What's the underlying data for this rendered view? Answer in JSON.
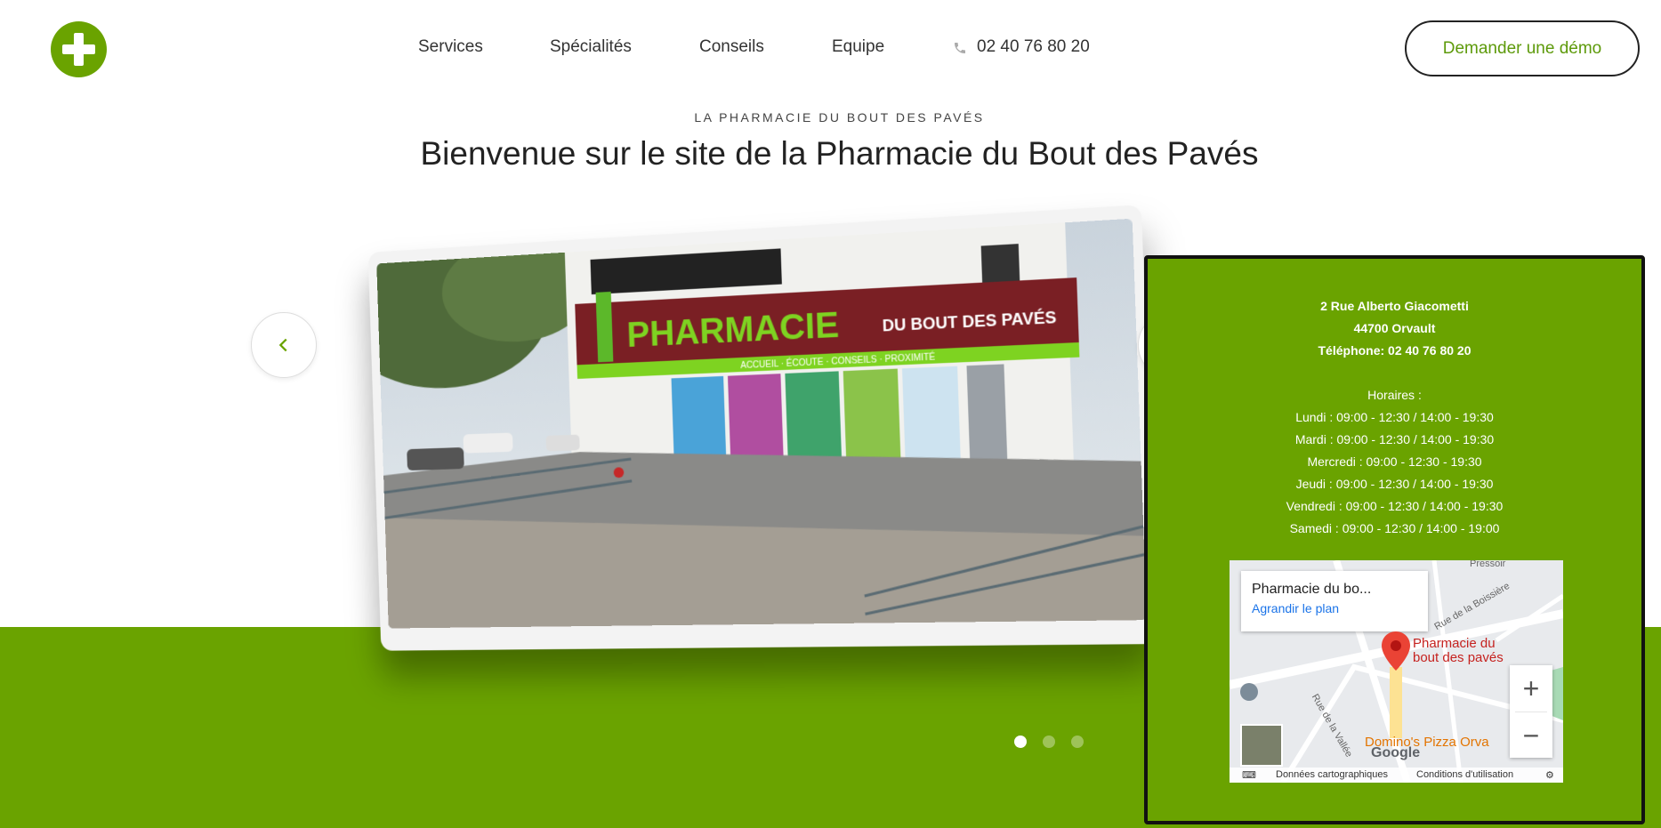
{
  "header": {
    "logo_icon": "plus-cross-icon",
    "nav": [
      {
        "label": "Services"
      },
      {
        "label": "Spécialités"
      },
      {
        "label": "Conseils"
      },
      {
        "label": "Equipe"
      }
    ],
    "phone_icon": "phone-icon",
    "phone": "02 40 76 80 20",
    "demo_button": "Demander une démo"
  },
  "hero": {
    "eyebrow": "LA PHARMACIE DU BOUT DES PAVÉS",
    "title": "Bienvenue sur le site de la Pharmacie du Bout des Pavés"
  },
  "carousel": {
    "photo_sign": "PHARMACIE",
    "photo_sign_right": "DU BOUT DES PAVÉS",
    "photo_strip": "ACCUEIL · ÉCOUTE · CONSEILS · PROXIMITÉ",
    "slides_count": 3,
    "active_slide": 1
  },
  "info": {
    "address_line1": "2 Rue Alberto Giacometti",
    "address_line2": "44700 Orvault",
    "phone_line": "Téléphone: 02 40 76 80 20",
    "hours_title": "Horaires :",
    "hours": [
      "Lundi : 09:00 - 12:30 / 14:00 - 19:30",
      "Mardi : 09:00 - 12:30 / 14:00 - 19:30",
      "Mercredi : 09:00 - 12:30 - 19:30",
      "Jeudi : 09:00 - 12:30 / 14:00 - 19:30",
      "Vendredi : 09:00 - 12:30 / 14:00 - 19:30",
      "Samedi : 09:00 - 12:30 / 14:00 - 19:00"
    ]
  },
  "map": {
    "card_title": "Pharmacie du bo...",
    "card_link": "Agrandir le plan",
    "pin_label_1": "Pharmacie du",
    "pin_label_2": "bout des pavés",
    "poi": "Domino's Pizza Orva",
    "google": "Google",
    "road_1": "Rue de la Boissière",
    "road_2": "Rue de la Vallée",
    "road_3": "Pressoir",
    "footer_data": "Données cartographiques",
    "footer_terms": "Conditions d'utilisation",
    "zoom_in": "+",
    "zoom_out": "−"
  },
  "colors": {
    "brand_green": "#6aa300",
    "demo_text": "#5d9a0a",
    "map_pin": "#c5221f"
  }
}
